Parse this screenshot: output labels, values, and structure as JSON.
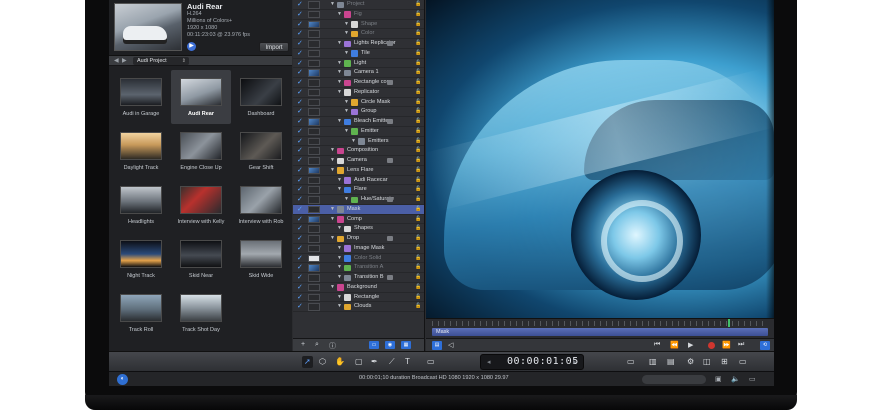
{
  "preview": {
    "title": "Audi Rear",
    "codec": "H.264",
    "colors": "Millions of Colors+",
    "size": "1920 x 1080",
    "duration": "00:11:23:03 @ 23.976 fps",
    "import_label": "Import"
  },
  "nav": {
    "project": "Audi Project"
  },
  "library": {
    "items": [
      {
        "label": "Audi in Garage",
        "selected": false
      },
      {
        "label": "Audi Rear",
        "selected": true
      },
      {
        "label": "Dashboard",
        "selected": false
      },
      {
        "label": "Daylight Track",
        "selected": false
      },
      {
        "label": "Engine Close Up",
        "selected": false
      },
      {
        "label": "Gear Shift",
        "selected": false
      },
      {
        "label": "Headlights",
        "selected": false
      },
      {
        "label": "Interview with Kelly",
        "selected": false
      },
      {
        "label": "Interview with Rob",
        "selected": false
      },
      {
        "label": "Night Track",
        "selected": false
      },
      {
        "label": "Skid Near",
        "selected": false
      },
      {
        "label": "Skid Wide",
        "selected": false
      },
      {
        "label": "Track Roll",
        "selected": false
      },
      {
        "label": "Track Shot Day",
        "selected": false
      }
    ]
  },
  "layers": {
    "rows": [
      {
        "name": "Project",
        "indent": 1,
        "dim": true
      },
      {
        "name": "Fig",
        "indent": 2,
        "dim": true
      },
      {
        "name": "Shape",
        "indent": 3,
        "dim": true
      },
      {
        "name": "Color",
        "indent": 3,
        "dim": true
      },
      {
        "name": "Lights Replicator",
        "indent": 2,
        "dim": false
      },
      {
        "name": "Tile",
        "indent": 3,
        "dim": false
      },
      {
        "name": "Light",
        "indent": 2,
        "dim": false
      },
      {
        "name": "Camera 1",
        "indent": 2,
        "dim": false
      },
      {
        "name": "Rectangle copy",
        "indent": 2,
        "dim": false
      },
      {
        "name": "Replicator",
        "indent": 2,
        "dim": false
      },
      {
        "name": "Circle Mask",
        "indent": 3,
        "dim": false
      },
      {
        "name": "Group",
        "indent": 3,
        "dim": false
      },
      {
        "name": "Bleach Emitter",
        "indent": 2,
        "dim": false
      },
      {
        "name": "Emitter",
        "indent": 3,
        "dim": false
      },
      {
        "name": "Emitters",
        "indent": 4,
        "dim": false
      },
      {
        "name": "Composition",
        "indent": 1,
        "dim": false
      },
      {
        "name": "Camera",
        "indent": 1,
        "dim": false
      },
      {
        "name": "Lens Flare",
        "indent": 1,
        "dim": false
      },
      {
        "name": "Audi Racecar",
        "indent": 2,
        "dim": false
      },
      {
        "name": "Flare",
        "indent": 2,
        "dim": false
      },
      {
        "name": "Hue/Saturate",
        "indent": 3,
        "dim": false
      },
      {
        "name": "Mask",
        "indent": 1,
        "dim": false,
        "highlight": true
      },
      {
        "name": "Comp",
        "indent": 1,
        "dim": false
      },
      {
        "name": "Shapes",
        "indent": 2,
        "dim": false
      },
      {
        "name": "Drop",
        "indent": 1,
        "dim": false
      },
      {
        "name": "Image Mask",
        "indent": 2,
        "dim": false
      },
      {
        "name": "Color Solid",
        "indent": 2,
        "dim": true
      },
      {
        "name": "Transition A",
        "indent": 2,
        "dim": true
      },
      {
        "name": "Transition B",
        "indent": 2,
        "dim": false
      },
      {
        "name": "Background",
        "indent": 1,
        "dim": false
      },
      {
        "name": "Rectangle",
        "indent": 2,
        "dim": false
      },
      {
        "name": "Clouds",
        "indent": 2,
        "dim": false
      }
    ]
  },
  "timing": {
    "track_label": "Mask",
    "playhead_fraction": 0.88
  },
  "timecode": {
    "value": "00:00:01:05"
  },
  "status": {
    "text": "00:00:01;10 duration Broadcast HD 1080 1920 x 1080 29.97"
  },
  "colors": {
    "accent": "#2e6fd8",
    "selection": "#4b5fa6",
    "record": "#d0362f"
  }
}
